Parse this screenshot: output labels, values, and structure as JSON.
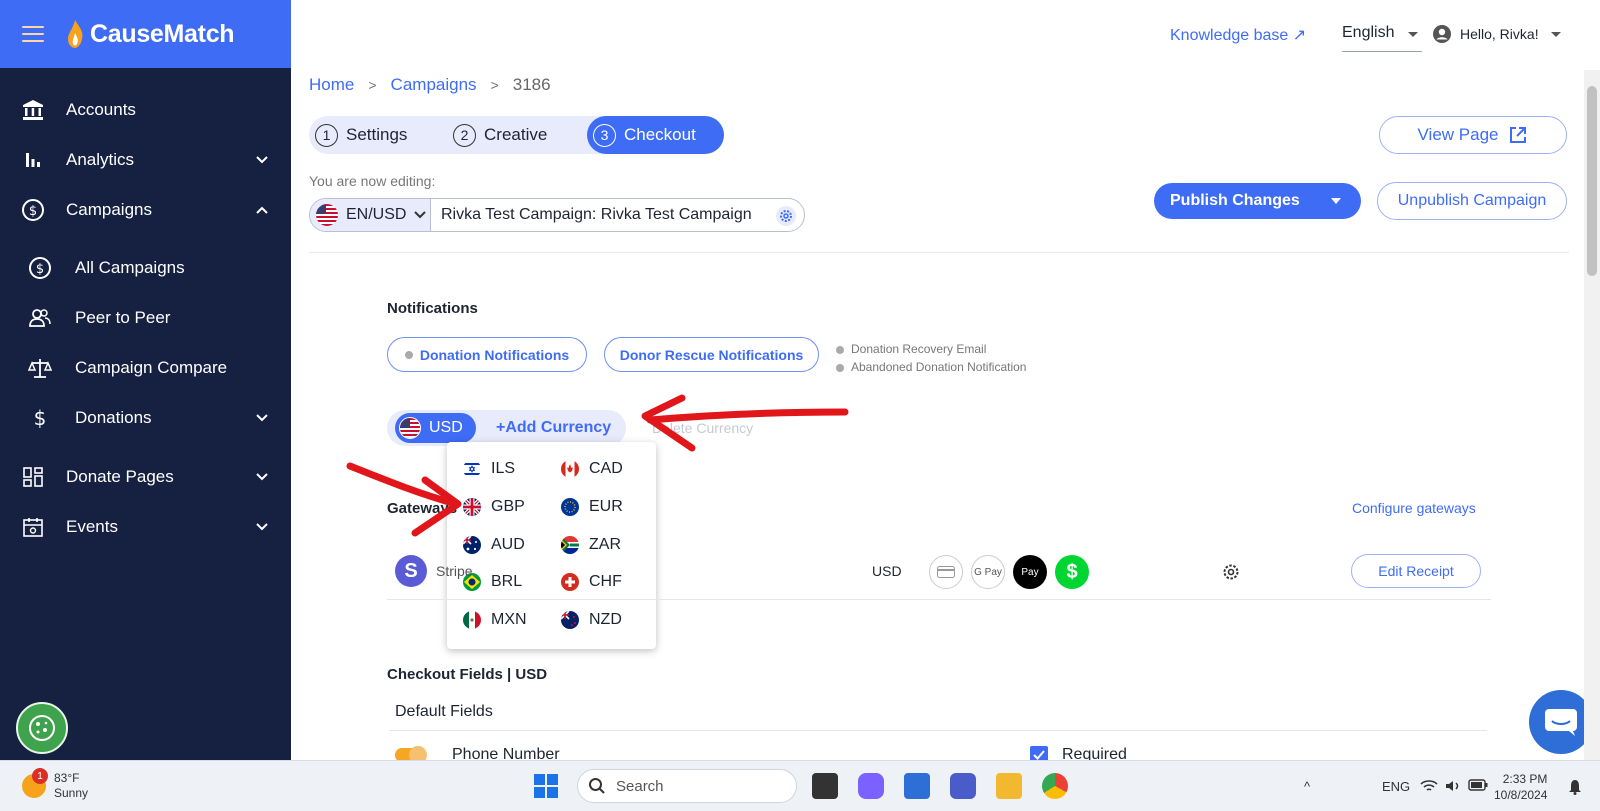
{
  "app": {
    "name": "CauseMatch"
  },
  "sidebar": {
    "items": [
      {
        "label": "Accounts",
        "icon": "bank-icon",
        "expandable": false
      },
      {
        "label": "Analytics",
        "icon": "bar-chart-icon",
        "expandable": true
      },
      {
        "label": "Campaigns",
        "icon": "dollar-circle-icon",
        "expandable": true,
        "expanded": true
      },
      {
        "label": "All Campaigns",
        "icon": "dollar-circle-icon",
        "sub": true
      },
      {
        "label": "Peer to Peer",
        "icon": "people-icon",
        "sub": true
      },
      {
        "label": "Campaign Compare",
        "icon": "scale-icon",
        "sub": true
      },
      {
        "label": "Donations",
        "icon": "dollar-icon",
        "sub": true,
        "expandable": true
      },
      {
        "label": "Donate Pages",
        "icon": "grid-icon",
        "expandable": true
      },
      {
        "label": "Events",
        "icon": "calendar-icon",
        "expandable": true
      }
    ]
  },
  "topbar": {
    "knowledge_base": "Knowledge base ↗",
    "language": "English",
    "greeting": "Hello, Rivka!"
  },
  "breadcrumb": {
    "home": "Home",
    "campaigns": "Campaigns",
    "current": "3186"
  },
  "stepper": [
    {
      "num": "1",
      "label": "Settings"
    },
    {
      "num": "2",
      "label": "Creative"
    },
    {
      "num": "3",
      "label": "Checkout",
      "active": true
    }
  ],
  "buttons": {
    "view_page": "View Page",
    "publish": "Publish Changes",
    "unpublish": "Unpublish Campaign"
  },
  "editing": {
    "label": "You are now editing:",
    "locale": "EN/USD",
    "campaign": "Rivka Test Campaign: Rivka Test Campaign"
  },
  "notifications": {
    "title": "Notifications",
    "donation_btn": "Donation Notifications",
    "rescue_btn": "Donor Rescue Notifications",
    "list": [
      "Donation Recovery Email",
      "Abandoned Donation Notification"
    ]
  },
  "currency": {
    "selected": "USD",
    "add": "+Add Currency",
    "delete": "Delete Currency",
    "options": [
      {
        "code": "ILS",
        "flag": "israel"
      },
      {
        "code": "CAD",
        "flag": "canada"
      },
      {
        "code": "GBP",
        "flag": "uk"
      },
      {
        "code": "EUR",
        "flag": "eu"
      },
      {
        "code": "AUD",
        "flag": "australia"
      },
      {
        "code": "ZAR",
        "flag": "south-africa"
      },
      {
        "code": "BRL",
        "flag": "brazil"
      },
      {
        "code": "CHF",
        "flag": "switzerland"
      },
      {
        "code": "MXN",
        "flag": "mexico"
      },
      {
        "code": "NZD",
        "flag": "new-zealand"
      }
    ]
  },
  "gateways": {
    "title": "Gateways",
    "configure": "Configure gateways",
    "row": {
      "name": "Stripe",
      "currency": "USD",
      "edit_receipt": "Edit Receipt"
    }
  },
  "checkout_fields": {
    "title": "Checkout Fields | USD",
    "default_fields": "Default Fields",
    "phone": "Phone Number",
    "required": "Required"
  },
  "taskbar": {
    "temp": "83°F",
    "weather": "Sunny",
    "weather_badge": "1",
    "search": "Search",
    "lang": "ENG",
    "time": "2:33 PM",
    "date": "10/8/2024"
  },
  "colors": {
    "accent": "#3f6cf5",
    "sidebar": "#162040",
    "annotation": "#e0161b"
  }
}
